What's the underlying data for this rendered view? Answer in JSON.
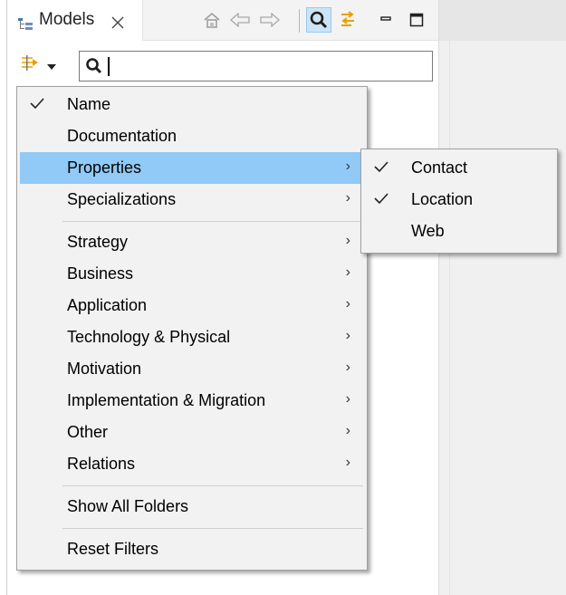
{
  "view": {
    "tab_title": "Models",
    "toolbar_icons": [
      "home-icon",
      "back-arrow-icon",
      "forward-arrow-icon",
      "search-icon",
      "link-sync-icon",
      "minimize-icon",
      "maximize-icon"
    ]
  },
  "filter": {
    "search_value": ""
  },
  "main_menu": {
    "items": [
      {
        "label": "Name",
        "checked": true
      },
      {
        "label": "Documentation",
        "checked": false
      },
      {
        "label": "Properties",
        "submenu": true,
        "highlighted": true
      },
      {
        "label": "Specializations",
        "submenu": true
      },
      {
        "label": "Strategy",
        "submenu": true
      },
      {
        "label": "Business",
        "submenu": true
      },
      {
        "label": "Application",
        "submenu": true
      },
      {
        "label": "Technology & Physical",
        "submenu": true
      },
      {
        "label": "Motivation",
        "submenu": true
      },
      {
        "label": "Implementation & Migration",
        "submenu": true
      },
      {
        "label": "Other",
        "submenu": true
      },
      {
        "label": "Relations",
        "submenu": true
      },
      {
        "label": "Show All Folders"
      },
      {
        "label": "Reset Filters"
      }
    ]
  },
  "properties_submenu": {
    "items": [
      {
        "label": "Contact",
        "checked": true
      },
      {
        "label": "Location",
        "checked": true
      },
      {
        "label": "Web",
        "checked": false
      }
    ]
  },
  "colors": {
    "highlight": "#91c9f7",
    "menu_bg": "#f2f2f2",
    "active_button": "#cce4f7",
    "link_icon": "#e8a000"
  }
}
